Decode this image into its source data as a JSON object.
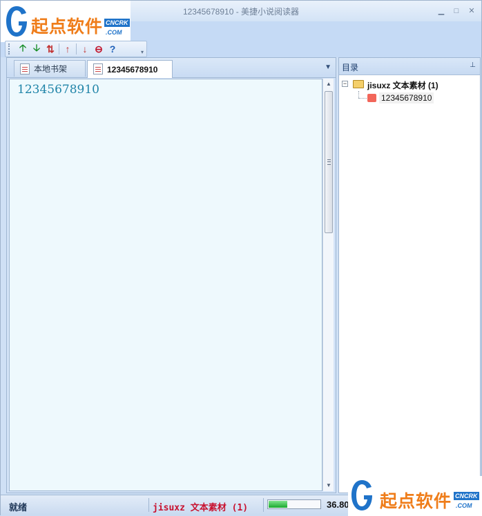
{
  "window": {
    "title": "12345678910 - 美捷小说阅读器",
    "minimize_glyph": "▁",
    "restore_glyph": "□",
    "close_glyph": "✕"
  },
  "logo": {
    "text": "起点软件",
    "badge_top": "CNCRK",
    "badge_bottom": ".COM"
  },
  "toolbar": {
    "buttons": [
      {
        "name": "move-up-green-icon",
        "glyph": "🡡",
        "color": "#1a8f2a"
      },
      {
        "name": "move-down-green-icon",
        "glyph": "🡣",
        "color": "#1a8f2a"
      },
      {
        "name": "sort-icon",
        "glyph": "⇅",
        "color": "#c23232"
      },
      {
        "name": "arrow-up-red-icon",
        "glyph": "↑",
        "color": "#c23232"
      },
      {
        "name": "arrow-down-red-icon",
        "glyph": "↓",
        "color": "#c23232"
      },
      {
        "name": "stop-icon",
        "glyph": "⊖",
        "color": "#c2142a"
      },
      {
        "name": "help-icon",
        "glyph": "?",
        "color": "#1d5fb8"
      }
    ],
    "overflow_glyph": "▾"
  },
  "tabs": [
    {
      "label": "本地书架",
      "active": false
    },
    {
      "label": "12345678910",
      "active": true
    }
  ],
  "tab_dropdown_glyph": "▼",
  "document": {
    "text": "12345678910"
  },
  "toc": {
    "title": "目录",
    "pin_glyph": "⊥",
    "folder": {
      "label": "jisuxz 文本素材 (1)",
      "expanded": true,
      "expander_glyph": "−"
    },
    "items": [
      {
        "label": "12345678910"
      }
    ]
  },
  "status": {
    "ready_text": "就绪",
    "current_book": "jisuxz 文本素材 (1)",
    "progress_fraction": 0.36,
    "percent_text": "36.80"
  },
  "colors": {
    "accent": "#1f84a8",
    "status_book": "#c8102e",
    "progress_green": "#1aa92f"
  }
}
